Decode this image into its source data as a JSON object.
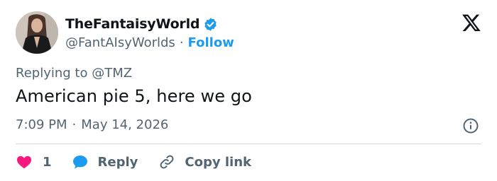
{
  "author": {
    "display_name": "TheFantaisyWorld",
    "handle": "@FantAIsyWorlds",
    "separator": "·",
    "follow_label": "Follow",
    "verified": true
  },
  "tweet": {
    "replying_to": "Replying to @TMZ",
    "text": "American pie 5, here we go",
    "time": "7:09 PM",
    "date": "May 14, 2026",
    "separator": "·"
  },
  "actions": {
    "like_count": "1",
    "reply_label": "Reply",
    "copy_link_label": "Copy link"
  },
  "icons": {
    "brand": "x-logo",
    "verified": "verified-badge-icon",
    "info": "info-icon",
    "like": "heart-icon",
    "reply": "speech-bubble-icon",
    "copy_link": "link-icon"
  },
  "colors": {
    "accent": "#1d9bf0",
    "like": "#f91880",
    "secondary_text": "#536471",
    "primary_text": "#0f1419",
    "divider": "#cfd9de"
  }
}
